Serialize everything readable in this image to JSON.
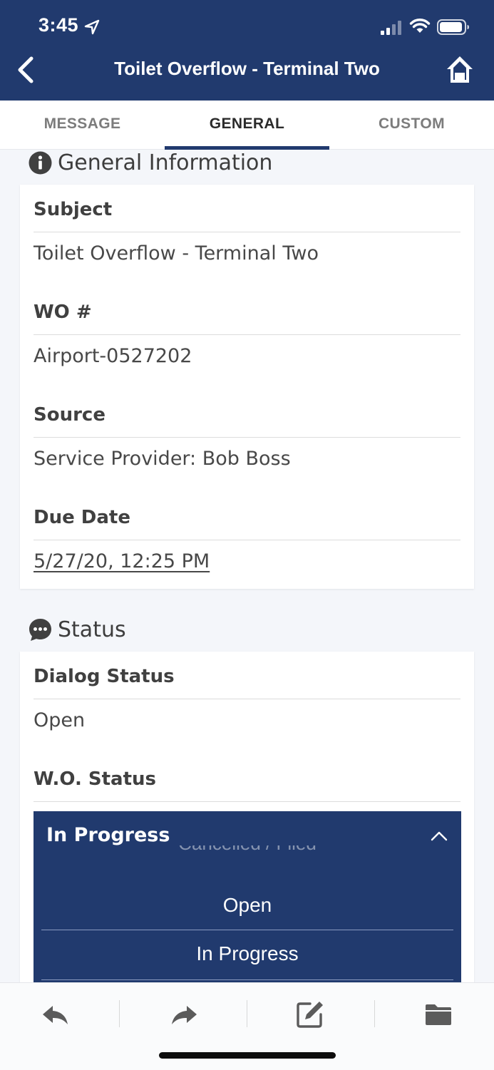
{
  "status_bar": {
    "time": "3:45"
  },
  "header": {
    "title": "Toilet Overflow - Terminal Two"
  },
  "tabs": [
    {
      "label": "MESSAGE"
    },
    {
      "label": "GENERAL"
    },
    {
      "label": "CUSTOM"
    }
  ],
  "general": {
    "section_title": "General Information",
    "fields": [
      {
        "label": "Subject",
        "value": "Toilet Overflow - Terminal Two"
      },
      {
        "label": "WO #",
        "value": "Airport-0527202"
      },
      {
        "label": "Source",
        "value": "Service Provider: Bob Boss"
      },
      {
        "label": "Due Date",
        "value": "5/27/20, 12:25 PM"
      }
    ]
  },
  "status": {
    "section_title": "Status",
    "dialog_status_label": "Dialog Status",
    "dialog_status_value": "Open",
    "wo_status_label": "W.O. Status",
    "wo_status_selected": "In Progress",
    "picker_options": [
      "Cancelled / Filed",
      "Open",
      "In Progress"
    ]
  },
  "toolbar": {
    "icons": [
      "reply-icon",
      "forward-icon",
      "compose-icon",
      "folder-icon"
    ]
  },
  "colors": {
    "brand": "#213a6e"
  }
}
